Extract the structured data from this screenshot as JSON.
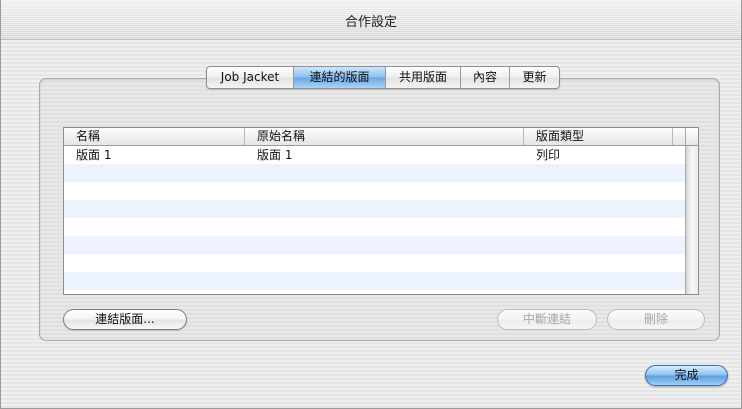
{
  "window": {
    "title": "合作設定"
  },
  "tabs": [
    {
      "label": "Job Jacket",
      "selected": false
    },
    {
      "label": "連結的版面",
      "selected": true
    },
    {
      "label": "共用版面",
      "selected": false
    },
    {
      "label": "內容",
      "selected": false
    },
    {
      "label": "更新",
      "selected": false
    }
  ],
  "table": {
    "columns": [
      "名稱",
      "原始名稱",
      "版面類型"
    ],
    "rows": [
      [
        "版面 1",
        "版面 1",
        "列印"
      ]
    ]
  },
  "buttons": {
    "link_layout": "連結版面...",
    "break_link": "中斷連結",
    "delete": "刪除",
    "done": "完成"
  },
  "colors": {
    "selected_tab": "#8cc1ee",
    "row_stripe": "#edf3fe",
    "default_button": "#5ea0e0",
    "disabled_text": "#a7a7a7"
  }
}
